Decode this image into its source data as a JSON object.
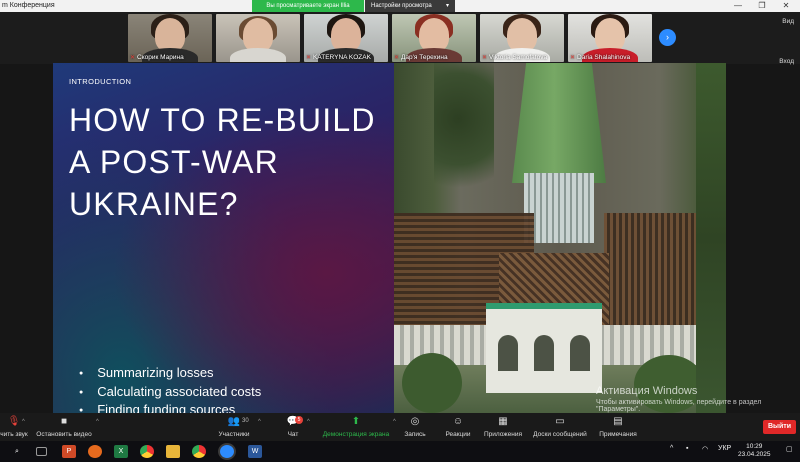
{
  "window": {
    "app_title": "m Конференция",
    "share_badge": "Вы просматриваете экран Illia",
    "view_settings": "Настройки просмотра",
    "minimize": "—",
    "maximize": "❐",
    "close": "✕"
  },
  "participants": [
    {
      "name": "Скорик Марина",
      "muted": true
    },
    {
      "name": "",
      "muted": false
    },
    {
      "name": "KATERYNA KOZAK",
      "muted": true
    },
    {
      "name": "Дар'я Терехина",
      "muted": true
    },
    {
      "name": "Viktoria Samofatova",
      "muted": true
    },
    {
      "name": "Daria Shalahinova",
      "muted": true
    }
  ],
  "strip": {
    "next_arrow": "›",
    "view_label": "Вид",
    "exit_label": "Вход"
  },
  "slide": {
    "section": "INTRODUCTION",
    "title": "HOW TO RE-BUILD A POST-WAR UKRAINE?",
    "bullets": [
      "Summarizing losses",
      "Calculating associated costs",
      "Finding funding sources"
    ]
  },
  "watermark": {
    "line1": "Активация Windows",
    "line2": "Чтобы активировать Windows, перейдите в раздел",
    "line3": "\"Параметры\"."
  },
  "toolbar": {
    "audio_label": "чить звук",
    "video_label": "Остановить видео",
    "participants_label": "Участники",
    "participants_count": "30",
    "chat_label": "Чат",
    "chat_badge": "5",
    "share_label": "Демонстрация экрана",
    "record_label": "Запись",
    "reactions_label": "Реакции",
    "apps_label": "Приложения",
    "whiteboard_label": "Доски сообщений",
    "notes_label": "Примечания",
    "leave_label": "Выйти"
  },
  "taskbar": {
    "language": "УКР",
    "time": "10:29",
    "date": "23.04.2025"
  },
  "colors": {
    "accent_blue": "#2d8cff",
    "share_green": "#2db84b",
    "leave_red": "#e02828"
  }
}
